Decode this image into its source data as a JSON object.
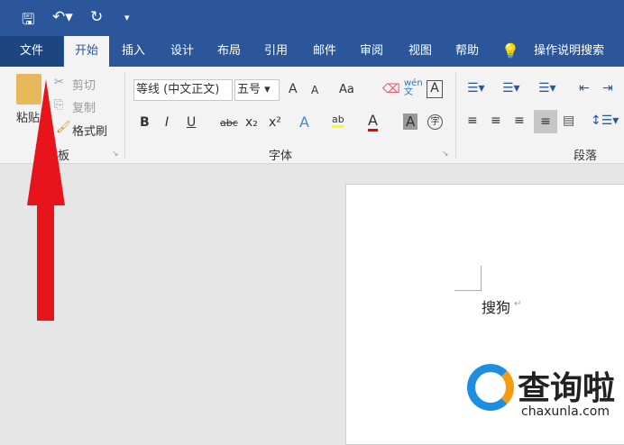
{
  "qat": {
    "icons": [
      "save-icon",
      "undo-icon",
      "redo-icon",
      "customize-icon"
    ]
  },
  "tabs": [
    "文件",
    "开始",
    "插入",
    "设计",
    "布局",
    "引用",
    "邮件",
    "审阅",
    "视图",
    "帮助"
  ],
  "tell_me": "操作说明搜索",
  "clipboard": {
    "paste": "粘贴",
    "cut": "剪切",
    "copy": "复制",
    "format_painter": "格式刷",
    "label": "剪贴板"
  },
  "font": {
    "name": "等线 (中文正文)",
    "size": "五号",
    "label": "字体",
    "bold": "B",
    "italic": "I",
    "underline": "U",
    "strike": "abc",
    "sub": "x₂",
    "sup": "x²",
    "grow": "A",
    "shrink": "A",
    "case": "Aa",
    "phonetic": "wén文",
    "border": "A",
    "effects": "A",
    "highlight": "ab",
    "color": "A",
    "shading": "A",
    "enclose": "字"
  },
  "paragraph": {
    "label": "段落"
  },
  "document": {
    "text": "搜狗"
  },
  "watermark": {
    "brand": "查询啦",
    "url": "chaxunla.com"
  },
  "colors": {
    "accent": "#2b579a",
    "arrow": "#e8141b"
  }
}
